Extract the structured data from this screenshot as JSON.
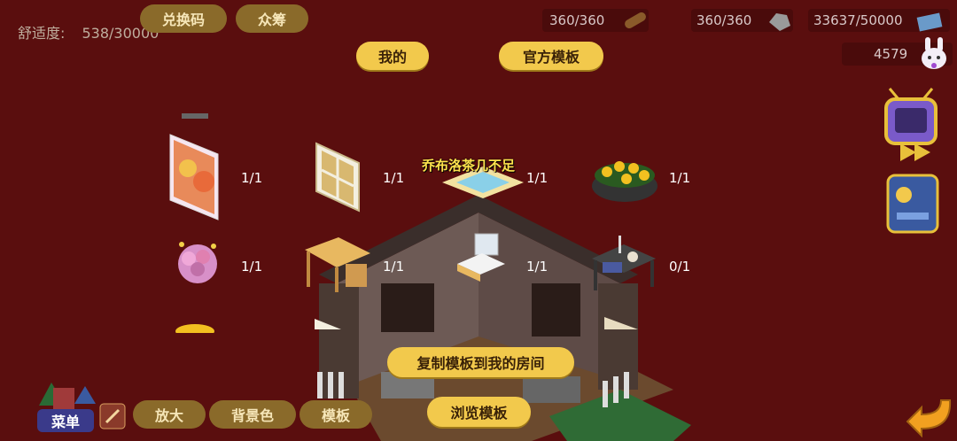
{
  "top": {
    "comfort_label": "舒适度:",
    "comfort_value": "538/30000",
    "exchange_button": "兑换码",
    "crowdfund_button": "众筹",
    "resources": [
      {
        "value": "360/360",
        "icon": "wood-icon"
      },
      {
        "value": "360/360",
        "icon": "stone-icon"
      },
      {
        "value": "33637/50000",
        "icon": "money-icon"
      }
    ],
    "rabbit_value": "4579"
  },
  "tabs": {
    "mine": "我的",
    "official": "官方模板"
  },
  "items": [
    {
      "count": "1/1",
      "icon": "painting-icon"
    },
    {
      "count": "1/1",
      "icon": "window-icon"
    },
    {
      "count": "1/1",
      "icon": "rug-icon"
    },
    {
      "count": "1/1",
      "icon": "flower-planter-icon"
    },
    {
      "count": "1/1",
      "icon": "flower-bouquet-icon"
    },
    {
      "count": "1/1",
      "icon": "desk-icon"
    },
    {
      "count": "1/1",
      "icon": "sink-icon"
    },
    {
      "count": "0/1",
      "icon": "tea-table-icon"
    }
  ],
  "tooltip": "乔布洛茶几不足",
  "actions": {
    "copy_template": "复制模板到我的房间",
    "browse_template": "浏览模板"
  },
  "bottom": {
    "menu_label": "菜单",
    "zoom": "放大",
    "background_color": "背景色",
    "template": "模板"
  }
}
